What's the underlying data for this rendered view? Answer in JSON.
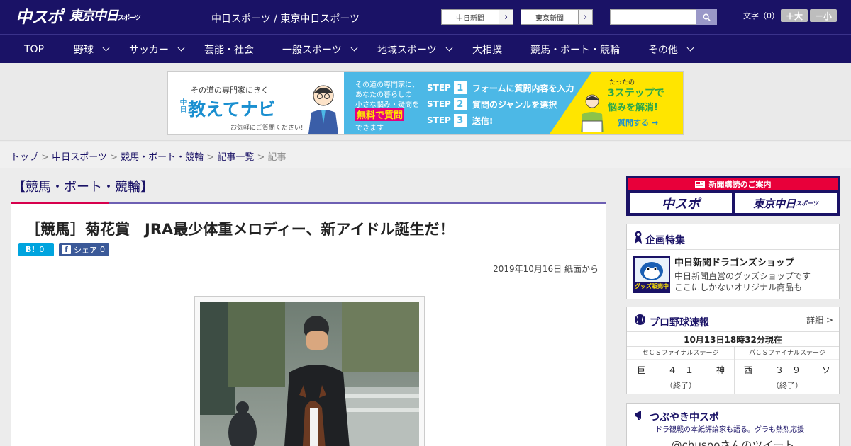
{
  "header": {
    "logo_chuspo": "中スポ",
    "logo_tokyo": "東京中日",
    "logo_tokyo_sub": "スポーツ",
    "site_name": "中日スポーツ / 東京中日スポーツ",
    "link_chunichi": "中日新聞",
    "link_tokyo": "東京新聞",
    "search_value": "",
    "font_size_label": "文字（0）",
    "font_larger": "＋大",
    "font_smaller": "－小"
  },
  "nav": {
    "items": [
      {
        "label": "TOP",
        "dropdown": false
      },
      {
        "label": "野球",
        "dropdown": true
      },
      {
        "label": "サッカー",
        "dropdown": true
      },
      {
        "label": "芸能・社会",
        "dropdown": false
      },
      {
        "label": "一般スポーツ",
        "dropdown": true
      },
      {
        "label": "地域スポーツ",
        "dropdown": true
      },
      {
        "label": "大相撲",
        "dropdown": false
      },
      {
        "label": "競馬・ボート・競輪",
        "dropdown": false
      },
      {
        "label": "その他",
        "dropdown": true
      }
    ]
  },
  "ad": {
    "tagline": "その道の専門家にきく",
    "brand_small": "中日",
    "brand": "教えてナビ",
    "note": "お気軽にご質問ください!",
    "mid_lines": [
      "その道の専門家に、",
      "あなたの暮らしの",
      "小さな悩み・疑問を"
    ],
    "mid_highlight": "無料で質問",
    "mid_end": "できます",
    "steps": [
      {
        "label": "STEP",
        "num": "1",
        "text": "フォームに質問内容を入力"
      },
      {
        "label": "STEP",
        "num": "2",
        "text": "質問のジャンルを選択"
      },
      {
        "label": "STEP",
        "num": "3",
        "text": "送信!"
      }
    ],
    "right_small": "たったの",
    "right_big": "3ステップで",
    "right_solve": "悩みを解消!",
    "right_cta": "質問する →"
  },
  "breadcrumb": {
    "items": [
      "トップ",
      "中日スポーツ",
      "競馬・ボート・競輪",
      "記事一覧"
    ],
    "current": "記事",
    "sep": ">"
  },
  "article": {
    "category": "【競馬・ボート・競輪】",
    "headline": "［競馬］菊花賞　JRA最少体重メロディー、新アイドル誕生だ！",
    "hatena_label": "B!",
    "hatena_count": "0",
    "fb_label": "シェア",
    "fb_count": "0",
    "date": "2019年10月16日 紙面から"
  },
  "sidebar": {
    "subscribe_header": "新聞購読のご案内",
    "subscribe_logo1": "中スポ",
    "subscribe_logo2": "東京中日",
    "subscribe_logo2_sub": "スポーツ",
    "feature": {
      "title": "企画特集",
      "item_title": "中日新聞ドラゴンズショップ",
      "item_desc1": "中日新聞直営のグッズショップです",
      "item_desc2": "ここにしかないオリジナル商品も",
      "thumb_text": "グッズ販売中"
    },
    "baseball": {
      "title": "プロ野球速報",
      "detail": "詳細 >",
      "time": "10月13日18時32分現在",
      "games": [
        {
          "stage": "セＣＳファイナルステージ",
          "home": "巨",
          "score": "４－１",
          "away": "神",
          "status": "（終了）"
        },
        {
          "stage": "パＣＳファイナルステージ",
          "home": "西",
          "score": "３－９",
          "away": "ソ",
          "status": "（終了）"
        }
      ]
    },
    "tweets": {
      "title": "つぶやき中スポ",
      "sub": "ドラ観戦の本紙評論家も語る。グラも熱烈応援",
      "handle": "@chuspoさんのツイート"
    }
  },
  "colors": {
    "header_bg": "#1a1266",
    "accent_red": "#d7004d",
    "accent_purple": "#6d5fb3",
    "ad_blue": "#4cb8e6",
    "ad_yellow": "#ffe500"
  }
}
